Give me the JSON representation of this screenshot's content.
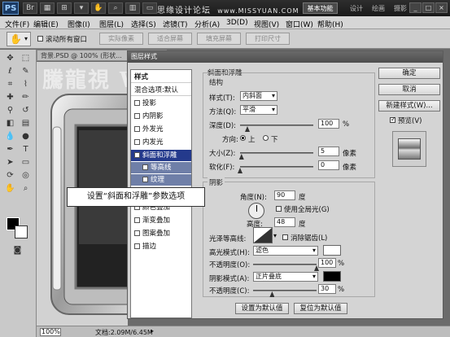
{
  "titlebar": {
    "logo": "PS",
    "watermark": "思缘设计论坛",
    "watermark_url": "www.MISSYUAN.COM",
    "workspace_active": "基本功能",
    "workspace_tabs": [
      "设计",
      "绘画",
      "摄影"
    ],
    "window_buttons": [
      "_",
      "□",
      "×"
    ]
  },
  "menubar": {
    "items": [
      "文件(F)",
      "编辑(E)",
      "图像(I)",
      "图层(L)",
      "选择(S)",
      "滤镜(T)",
      "分析(A)",
      "3D(D)",
      "视图(V)",
      "窗口(W)",
      "帮助(H)"
    ]
  },
  "options": {
    "scroll_all_label": "滚动所有窗口",
    "buttons": [
      "实际像素",
      "适合屏幕",
      "填充屏幕",
      "打印尺寸"
    ]
  },
  "document": {
    "tab_title": "背景.PSD @ 100% (形状...",
    "zoom": "100%",
    "doc_info": "文档:2.09M/6.45M"
  },
  "watermark_body": "騰龍視     WWW.TLVI.NET",
  "callout": "设置“斜面和浮雕”参数选项",
  "dialog": {
    "title": "图层样式",
    "style_list": {
      "header": "样式",
      "blend": "混合选项:默认",
      "items": [
        {
          "label": "投影",
          "checked": false
        },
        {
          "label": "内阴影",
          "checked": false
        },
        {
          "label": "外发光",
          "checked": false
        },
        {
          "label": "内发光",
          "checked": false
        },
        {
          "label": "斜面和浮雕",
          "checked": true
        },
        {
          "label": "等高线",
          "checked": false
        },
        {
          "label": "纹理",
          "checked": false
        },
        {
          "label": "光泽",
          "checked": false
        },
        {
          "label": "颜色叠加",
          "checked": false
        },
        {
          "label": "渐变叠加",
          "checked": false
        },
        {
          "label": "图案叠加",
          "checked": false
        },
        {
          "label": "描边",
          "checked": false
        }
      ]
    },
    "bevel": {
      "section_title": "斜面和浮雕",
      "structure_title": "结构",
      "style_label": "样式(T):",
      "style_value": "内斜面",
      "method_label": "方法(Q):",
      "method_value": "平滑",
      "depth_label": "深度(D):",
      "depth_value": "100",
      "depth_unit": "%",
      "depth_level": 0.1,
      "direction_label": "方向:",
      "direction_up": "上",
      "direction_down": "下",
      "size_label": "大小(Z):",
      "size_value": "5",
      "size_unit": "像素",
      "size_level": 0.02,
      "soften_label": "软化(F):",
      "soften_value": "0",
      "soften_unit": "像素",
      "soften_level": 0
    },
    "shading": {
      "section_title": "阴影",
      "angle_label": "角度(N):",
      "angle_value": "90",
      "angle_unit": "度",
      "global_light_label": "使用全局光(G)",
      "altitude_label": "高度:",
      "altitude_value": "48",
      "altitude_unit": "度",
      "gloss_label": "光泽等高线:",
      "antialias_label": "消除锯齿(L)",
      "highlight_mode_label": "高光模式(H):",
      "highlight_mode_value": "滤色",
      "highlight_color": "#ffffff",
      "highlight_opacity_label": "不透明度(O):",
      "highlight_opacity_value": "100",
      "highlight_opacity_level": 1.0,
      "shadow_mode_label": "阴影模式(A):",
      "shadow_mode_value": "正片叠底",
      "shadow_color": "#000000",
      "shadow_opacity_label": "不透明度(C):",
      "shadow_opacity_value": "30",
      "shadow_opacity_level": 0.3,
      "percent": "%"
    },
    "footer": {
      "set_default": "设置为默认值",
      "reset_default": "复位为默认值"
    },
    "right": {
      "ok": "确定",
      "cancel": "取消",
      "new_style": "新建样式(W)...",
      "preview_label": "预览(V)"
    }
  }
}
